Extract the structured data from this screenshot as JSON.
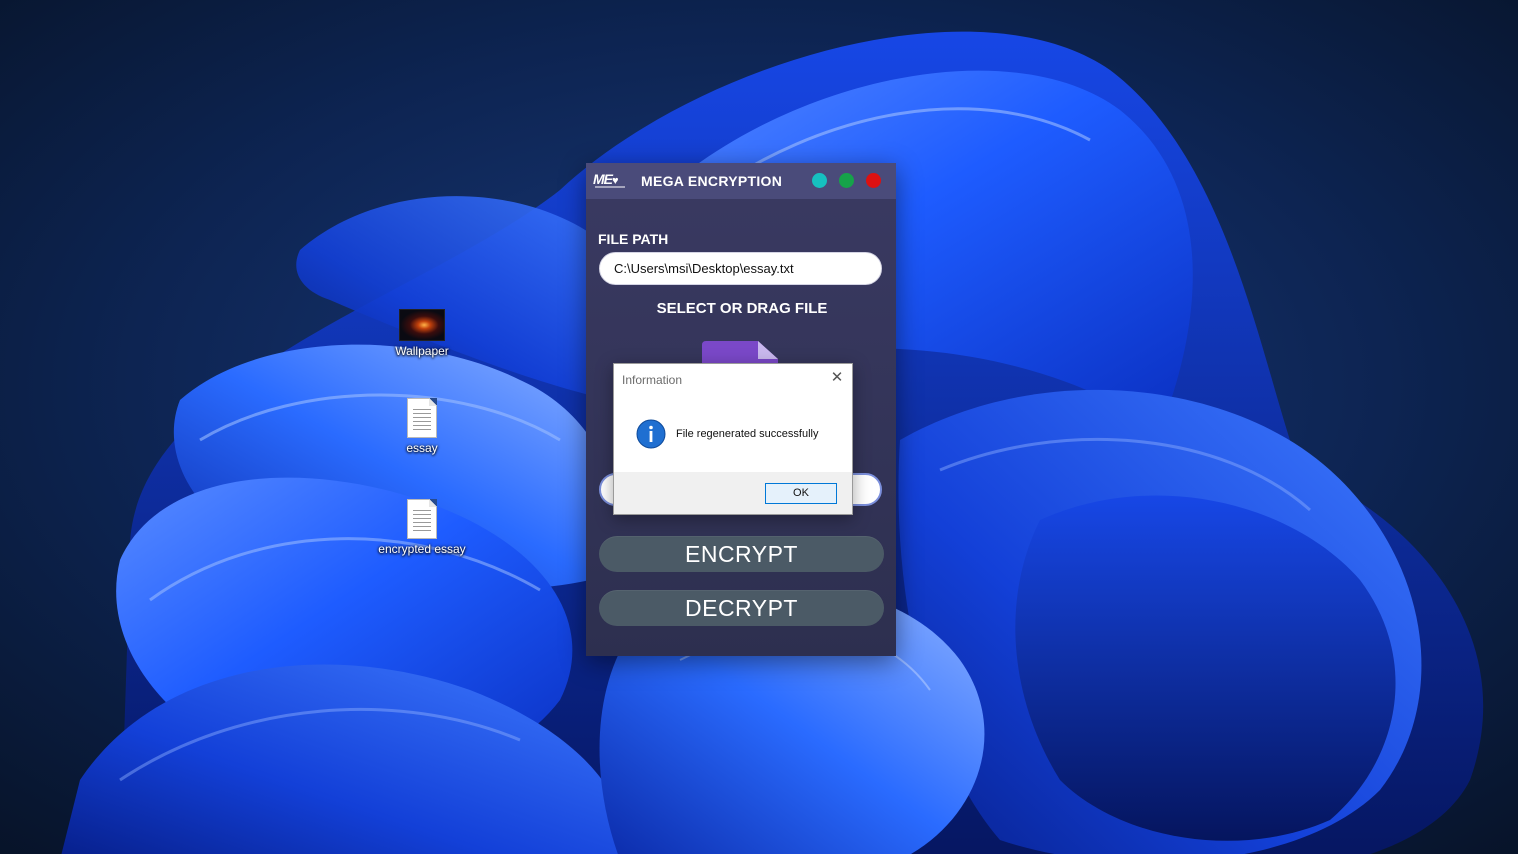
{
  "desktop": {
    "icons": [
      {
        "label": "Wallpaper",
        "icon": "image-file-icon"
      },
      {
        "label": "essay",
        "icon": "text-document-icon"
      },
      {
        "label": "encrypted essay",
        "icon": "text-document-icon"
      }
    ]
  },
  "app": {
    "title": "MEGA ENCRYPTION",
    "logo_text": "ME",
    "file_path_label": "FILE PATH",
    "file_path_value": "C:\\Users\\msi\\Desktop\\essay.txt",
    "select_drag_label": "SELECT OR DRAG FILE",
    "encrypt_label": "ENCRYPT",
    "decrypt_label": "DECRYPT",
    "colors": {
      "window_bg": "#333458",
      "titlebar": "#4a4b7a",
      "minimize_dot": "#16c0c0",
      "maximize_dot": "#16a34a",
      "close_dot": "#dc1111",
      "button_bg": "#4b5a66",
      "file_icon": "#7a48c8"
    }
  },
  "dialog": {
    "title": "Information",
    "message": "File regenerated successfully",
    "ok_label": "OK",
    "close_glyph": "✕"
  }
}
